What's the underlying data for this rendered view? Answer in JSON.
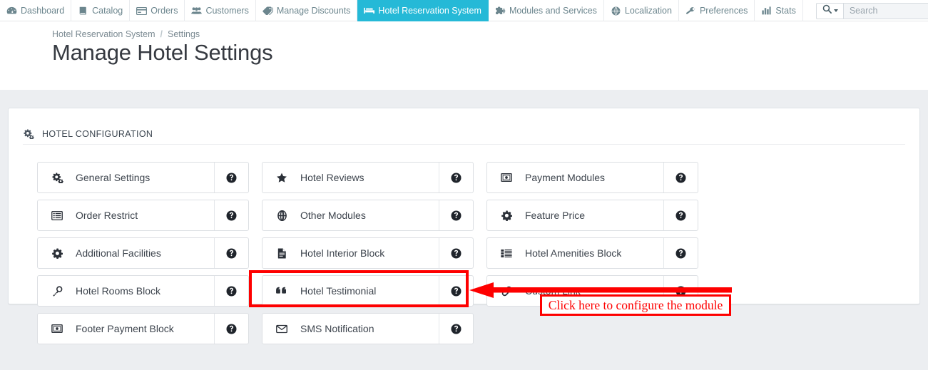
{
  "topnav": {
    "items": [
      {
        "label": "Dashboard",
        "icon": "speedometer-icon",
        "active": false
      },
      {
        "label": "Catalog",
        "icon": "book-icon",
        "active": false
      },
      {
        "label": "Orders",
        "icon": "credit-card-icon",
        "active": false
      },
      {
        "label": "Customers",
        "icon": "people-icon",
        "active": false
      },
      {
        "label": "Manage Discounts",
        "icon": "tag-icon",
        "active": false
      },
      {
        "label": "Hotel Reservation System",
        "icon": "bed-icon",
        "active": true
      },
      {
        "label": "Modules and Services",
        "icon": "puzzle-icon",
        "active": false
      },
      {
        "label": "Localization",
        "icon": "globe-icon",
        "active": false
      },
      {
        "label": "Preferences",
        "icon": "wrench-icon",
        "active": false
      },
      {
        "label": "Stats",
        "icon": "bar-chart-icon",
        "active": false
      }
    ],
    "search": {
      "dropdown_icon": "search-icon",
      "placeholder": "Search",
      "value": ""
    },
    "more_icon": "more-options-icon",
    "active_color": "#25b9d7"
  },
  "header": {
    "breadcrumb": {
      "parent": "Hotel Reservation System",
      "separator": "/",
      "current": "Settings"
    },
    "title": "Manage Hotel Settings"
  },
  "panel": {
    "icon": "gears-icon",
    "title": "HOTEL CONFIGURATION",
    "help_icon": "question-circle-icon",
    "tiles": [
      {
        "label": "General Settings",
        "icon": "gears-icon",
        "help": "question-circle-icon",
        "highlighted": false
      },
      {
        "label": "Hotel Reviews",
        "icon": "star-icon",
        "help": "question-circle-icon",
        "highlighted": false
      },
      {
        "label": "Payment Modules",
        "icon": "money-icon",
        "help": "question-circle-icon",
        "highlighted": false
      },
      {
        "label": "Order Restrict",
        "icon": "list-alt-icon",
        "help": "question-circle-icon",
        "highlighted": false
      },
      {
        "label": "Other Modules",
        "icon": "globe-icon",
        "help": "question-circle-icon",
        "highlighted": false
      },
      {
        "label": "Feature Price",
        "icon": "gear-icon",
        "help": "question-circle-icon",
        "highlighted": false
      },
      {
        "label": "Additional Facilities",
        "icon": "gear-icon",
        "help": "question-circle-icon",
        "highlighted": false
      },
      {
        "label": "Hotel Interior Block",
        "icon": "file-text-icon",
        "help": "question-circle-icon",
        "highlighted": false
      },
      {
        "label": "Hotel Amenities Block",
        "icon": "list-icon",
        "help": "question-circle-icon",
        "highlighted": false
      },
      {
        "label": "Hotel Rooms Block",
        "icon": "key-icon",
        "help": "question-circle-icon",
        "highlighted": false
      },
      {
        "label": "Hotel Testimonial",
        "icon": "quote-left-icon",
        "help": "question-circle-icon",
        "highlighted": false
      },
      {
        "label": "Custom Link",
        "icon": "link-icon",
        "help": "question-circle-icon",
        "highlighted": false
      },
      {
        "label": "Footer Payment Block",
        "icon": "money-icon",
        "help": "question-circle-icon",
        "highlighted": false
      },
      {
        "label": "SMS Notification",
        "icon": "envelope-icon",
        "help": "question-circle-icon",
        "highlighted": true
      }
    ]
  },
  "annotation": {
    "color": "#fe0000",
    "callout_text": "Click here to configure the module",
    "arrow_direction": "left",
    "highlight_target": "SMS Notification"
  }
}
